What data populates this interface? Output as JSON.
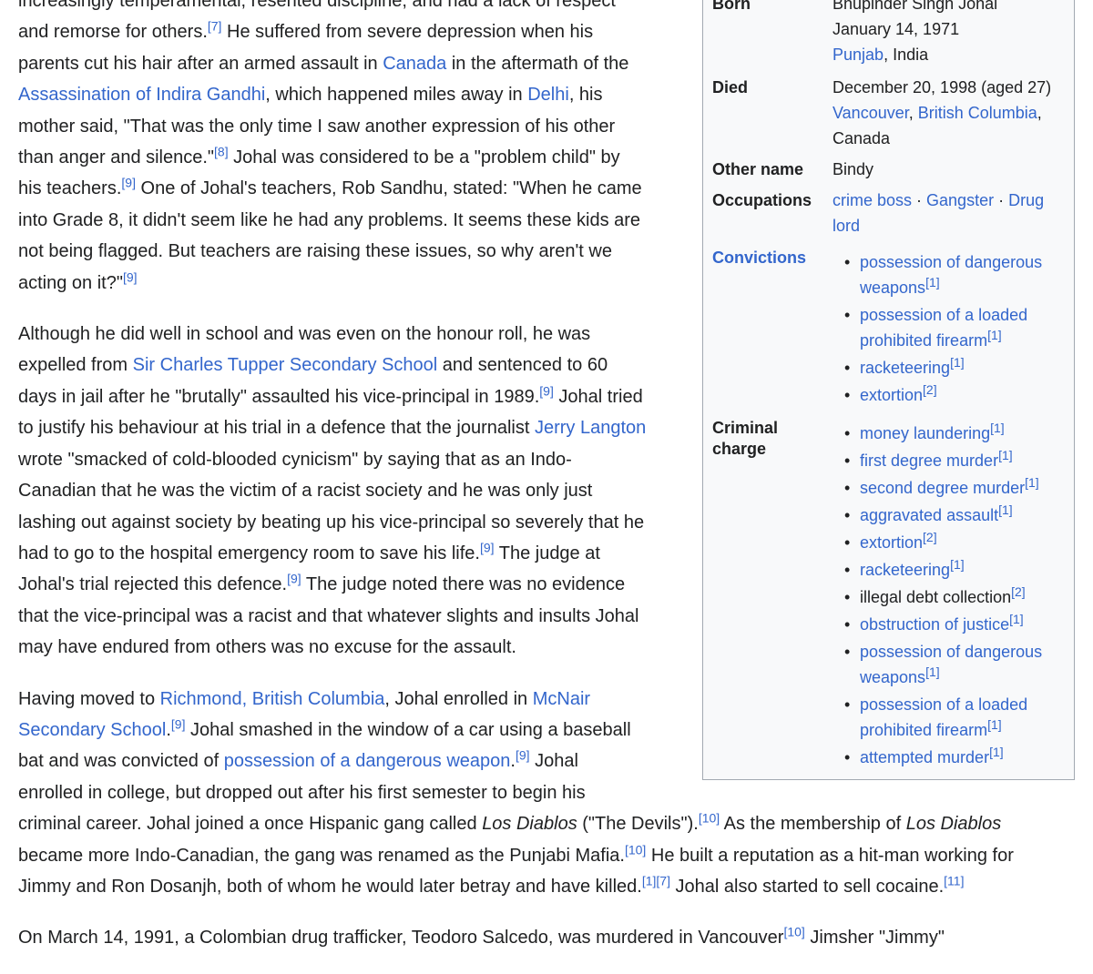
{
  "infobox": {
    "born": {
      "label": "Born",
      "name": "Bhupinder Singh Johal",
      "date": "January 14, 1971",
      "place_link": "Punjab",
      "place_rest": ", India"
    },
    "died": {
      "label": "Died",
      "date": "December 20, 1998 (aged 27)",
      "city_link": "Vancouver",
      "sep": ", ",
      "province_link": "British Columbia",
      "comma": ",",
      "country": "Canada"
    },
    "other_name": {
      "label": "Other name",
      "value": "Bindy"
    },
    "occupations": {
      "label": "Occupations",
      "items": [
        "crime boss",
        "Gangster",
        "Drug",
        "lord"
      ],
      "separator": " · "
    },
    "convictions": {
      "label": "Convictions",
      "items": [
        {
          "line1": "possession of dangerous",
          "line2": "weapons",
          "ref": "[1]"
        },
        {
          "line1": "possession of a loaded",
          "line2": "prohibited firearm",
          "ref": "[1]"
        },
        {
          "line1": "racketeering",
          "ref": "[1]"
        },
        {
          "line1": "extortion",
          "ref": "[2]"
        }
      ]
    },
    "criminal_charge": {
      "label_line1": "Criminal",
      "label_line2": "charge",
      "items": [
        {
          "line1": "money laundering",
          "ref": "[1]"
        },
        {
          "line1": "first degree murder",
          "ref": "[1]"
        },
        {
          "line1": "second degree murder",
          "ref": "[1]"
        },
        {
          "line1": "aggravated assault",
          "ref": "[1]"
        },
        {
          "line1": "extortion",
          "ref": "[2]"
        },
        {
          "line1": "racketeering",
          "ref": "[1]"
        },
        {
          "line1": "illegal debt collection",
          "ref": "[2]"
        },
        {
          "line1": "obstruction of justice",
          "ref": "[1]"
        },
        {
          "line1": "possession of dangerous",
          "line2": "weapons",
          "ref": "[1]"
        },
        {
          "line1": "possession of a loaded",
          "line2": "prohibited firearm",
          "ref": "[1]"
        },
        {
          "line1": "attempted murder",
          "ref": "[1]"
        }
      ]
    }
  },
  "article": {
    "p1": {
      "l1": "increasingly temperamental, resented discipline, and had a lack of respect",
      "l2a": "and remorse for others.",
      "r7": "[7]",
      "l2b": " He suffered from severe depression when his",
      "l3a": "parents cut his hair after an armed assault in ",
      "canada": "Canada",
      "l3b": " in the aftermath of the",
      "indira": "Assassination of Indira Gandhi",
      "l4a": ", which happened miles away in ",
      "delhi": "Delhi",
      "l4b": ", his",
      "l5": "mother said, \"That was the only time I saw another expression of his other",
      "l6a": "than anger and silence.\"",
      "r8": "[8]",
      "l6b": " Johal was considered to be a \"problem child\" by",
      "l7a": "his teachers.",
      "r9a": "[9]",
      "l7b": " One of Johal's teachers, Rob Sandhu, stated: \"When he came",
      "l8": "into Grade 8, it didn't seem like he had any problems. It seems these kids are",
      "l9": "not being flagged. But teachers are raising these issues, so why aren't we",
      "l10": "acting on it?\"",
      "r9b": "[9]"
    },
    "p2": {
      "l1": "Although he did well in school and was even on the honour roll, he was",
      "l2a": "expelled from ",
      "tupper": "Sir Charles Tupper Secondary School",
      "l2b": " and sentenced to 60",
      "l3a": "days in jail after he \"brutally\" assaulted his vice-principal in 1989.",
      "r9a": "[9]",
      "l3b": " Johal tried",
      "l4a": "to justify his behaviour at his trial in a defence that the journalist ",
      "langton": "Jerry Langton",
      "l5": "wrote \"smacked of cold-blooded cynicism\" by saying that as an Indo-",
      "l6": "Canadian that he was the victim of a racist society and he was only just",
      "l7": "lashing out against society by beating up his vice-principal so severely that he",
      "l8a": "had to go to the hospital emergency room to save his life.",
      "r9b": "[9]",
      "l8b": " The judge at",
      "l9a": "Johal's trial rejected this defence.",
      "r9c": "[9]",
      "l9b": " The judge noted there was no evidence",
      "l10": "that the vice-principal was a racist and that whatever slights and insults Johal",
      "l11": "may have endured from others was no excuse for the assault."
    },
    "p3": {
      "l1a": "Having moved to ",
      "richmond": "Richmond, British Columbia",
      "l1b": ", Johal enrolled in ",
      "mcnair1": "McNair",
      "mcnair2": "Secondary School",
      "l2a": ".",
      "r9a": "[9]",
      "l2b": " Johal smashed in the window of a car using a baseball",
      "l3a": "bat and was convicted of ",
      "weapon": "possession of a dangerous weapon",
      "l3b": ".",
      "r9b": "[9]",
      "l3c": " Johal",
      "l4": "enrolled in college, but dropped out after his first semester to begin his",
      "l5a": "criminal career. Johal joined a once Hispanic gang called ",
      "diablos1": "Los Diablos",
      "l5b": " (\"The Devils\").",
      "r10a": "[10]",
      "l5c": " As the membership of ",
      "diablos2": "Los Diablos",
      "l6a": "became more Indo-Canadian, the gang was renamed as the Punjabi Mafia.",
      "r10b": "[10]",
      "l6b": " He built a reputation as a hit-man working for",
      "l7a": "Jimmy and Ron Dosanjh, both of whom he would later betray and have killed.",
      "r1": "[1]",
      "r7": "[7]",
      "l7b": " Johal also started to sell cocaine.",
      "r11": "[11]"
    },
    "p4": {
      "l1a": "On March 14, 1991, a Colombian drug trafficker, Teodoro Salcedo, was murdered in Vancouver",
      "r10": "[10]",
      "l1b": " Jimsher \"Jimmy\""
    }
  }
}
